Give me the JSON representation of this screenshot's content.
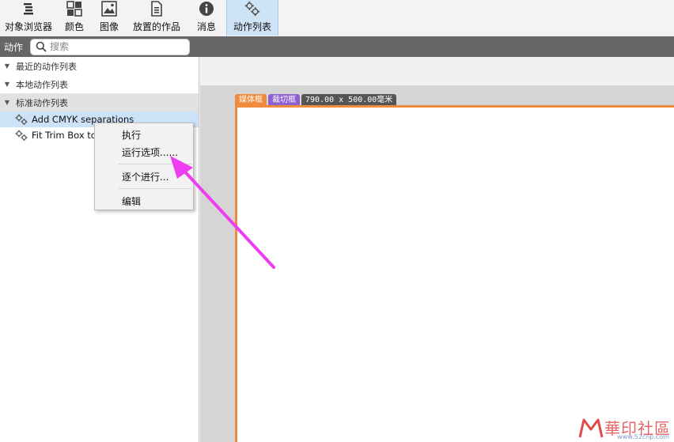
{
  "toolbar": {
    "items": [
      {
        "label": "对象浏览器",
        "icon": "object-browser-icon"
      },
      {
        "label": "颜色",
        "icon": "color-grid-icon"
      },
      {
        "label": "图像",
        "icon": "image-icon"
      },
      {
        "label": "放置的作品",
        "icon": "placed-document-icon"
      },
      {
        "label": "消息",
        "icon": "info-icon"
      },
      {
        "label": "动作列表",
        "icon": "gears-icon",
        "active": true
      }
    ]
  },
  "section": {
    "title": "动作",
    "search_placeholder": "搜索"
  },
  "tree": {
    "groups": [
      {
        "label": "最近的动作列表"
      },
      {
        "label": "本地动作列表"
      },
      {
        "label": "标准动作列表",
        "selected": true
      }
    ],
    "items": [
      {
        "label": "Add CMYK separations",
        "highlighted": true
      },
      {
        "label": "Fit Trim Box to"
      }
    ]
  },
  "canvas": {
    "tab_media": "媒体框",
    "tab_trim": "裁切框",
    "dims": "790.00 x 500.00毫米"
  },
  "context_menu": {
    "items": [
      "执行",
      "运行选项......",
      "逐个进行...",
      "编辑"
    ]
  },
  "watermark": {
    "brand": "華印社區",
    "url": "www.52cnp.com"
  },
  "colors": {
    "accent_orange": "#f08a3c",
    "trim_purple": "#8e5fd0",
    "arrow_magenta": "#ee3cf0",
    "selection_blue": "#cce2f7"
  }
}
